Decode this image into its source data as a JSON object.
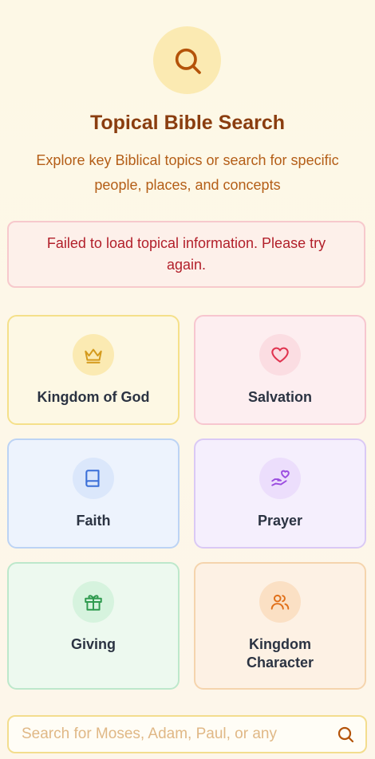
{
  "header": {
    "icon": "search-icon",
    "title": "Topical Bible Search",
    "subtitle": "Explore key Biblical topics or search for specific people, places, and concepts"
  },
  "error": {
    "message": "Failed to load topical information. Please try again."
  },
  "topics": [
    {
      "label": "Kingdom of God",
      "icon": "crown-icon",
      "color": "#d49a1c"
    },
    {
      "label": "Salvation",
      "icon": "heart-icon",
      "color": "#e0334f"
    },
    {
      "label": "Faith",
      "icon": "book-icon",
      "color": "#3b6fd8"
    },
    {
      "label": "Prayer",
      "icon": "hand-heart-icon",
      "color": "#9b4de0"
    },
    {
      "label": "Giving",
      "icon": "gift-icon",
      "color": "#2e9a4e"
    },
    {
      "label": "Kingdom Character",
      "icon": "users-icon",
      "color": "#e0701a"
    }
  ],
  "search": {
    "placeholder": "Search for Moses, Adam, Paul, or any",
    "value": ""
  },
  "colors": {
    "title": "#8a3d0f",
    "subtitle": "#b45e17",
    "error_text": "#b21f2a"
  }
}
